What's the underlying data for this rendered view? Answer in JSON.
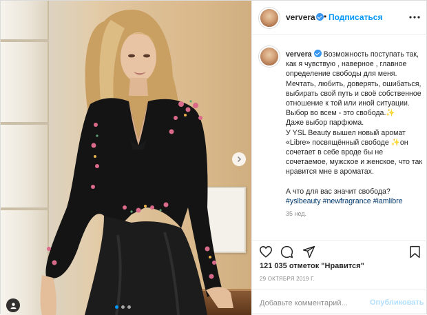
{
  "post": {
    "username": "ververa",
    "follow_label": "Подписаться",
    "separator": "•",
    "caption": "Возможность поступать так, как я чувствую , наверное , главное определение свободы для меня. Мечтать, любить, доверять, ошибаться, выбирать свой путь и своё собственное отношение к той или иной ситуации.\nВыбор во всем - это свобода.✨\nДаже выбор парфюма.\nУ YSL Beauty вышел новый аромат «Libre» посвящённый свободе ✨он сочетает в себе вроде бы не сочетаемое, мужское и женское, что так нравится мне в ароматах.\n\nА что для вас значит свобода?\n",
    "hashtags": "#yslbeauty #newfragrance #iamlibre",
    "time_ago": "35 нед.",
    "likes": "121 035 отметок \"Нравится\"",
    "date": "29 ОКТЯБРЯ 2019 Г.",
    "comment_placeholder": "Добавьте комментарий...",
    "publish_label": "Опубликовать"
  },
  "carousel": {
    "slides": 3,
    "active": 1
  },
  "colors": {
    "accent": "#0095f6",
    "link": "#00376b",
    "muted": "#8e8e8e",
    "verified": "#3897f0"
  },
  "icons": [
    "verified-icon",
    "more-icon",
    "heart-icon",
    "comment-icon",
    "share-icon",
    "bookmark-icon",
    "next-arrow-icon",
    "tag-user-icon"
  ]
}
